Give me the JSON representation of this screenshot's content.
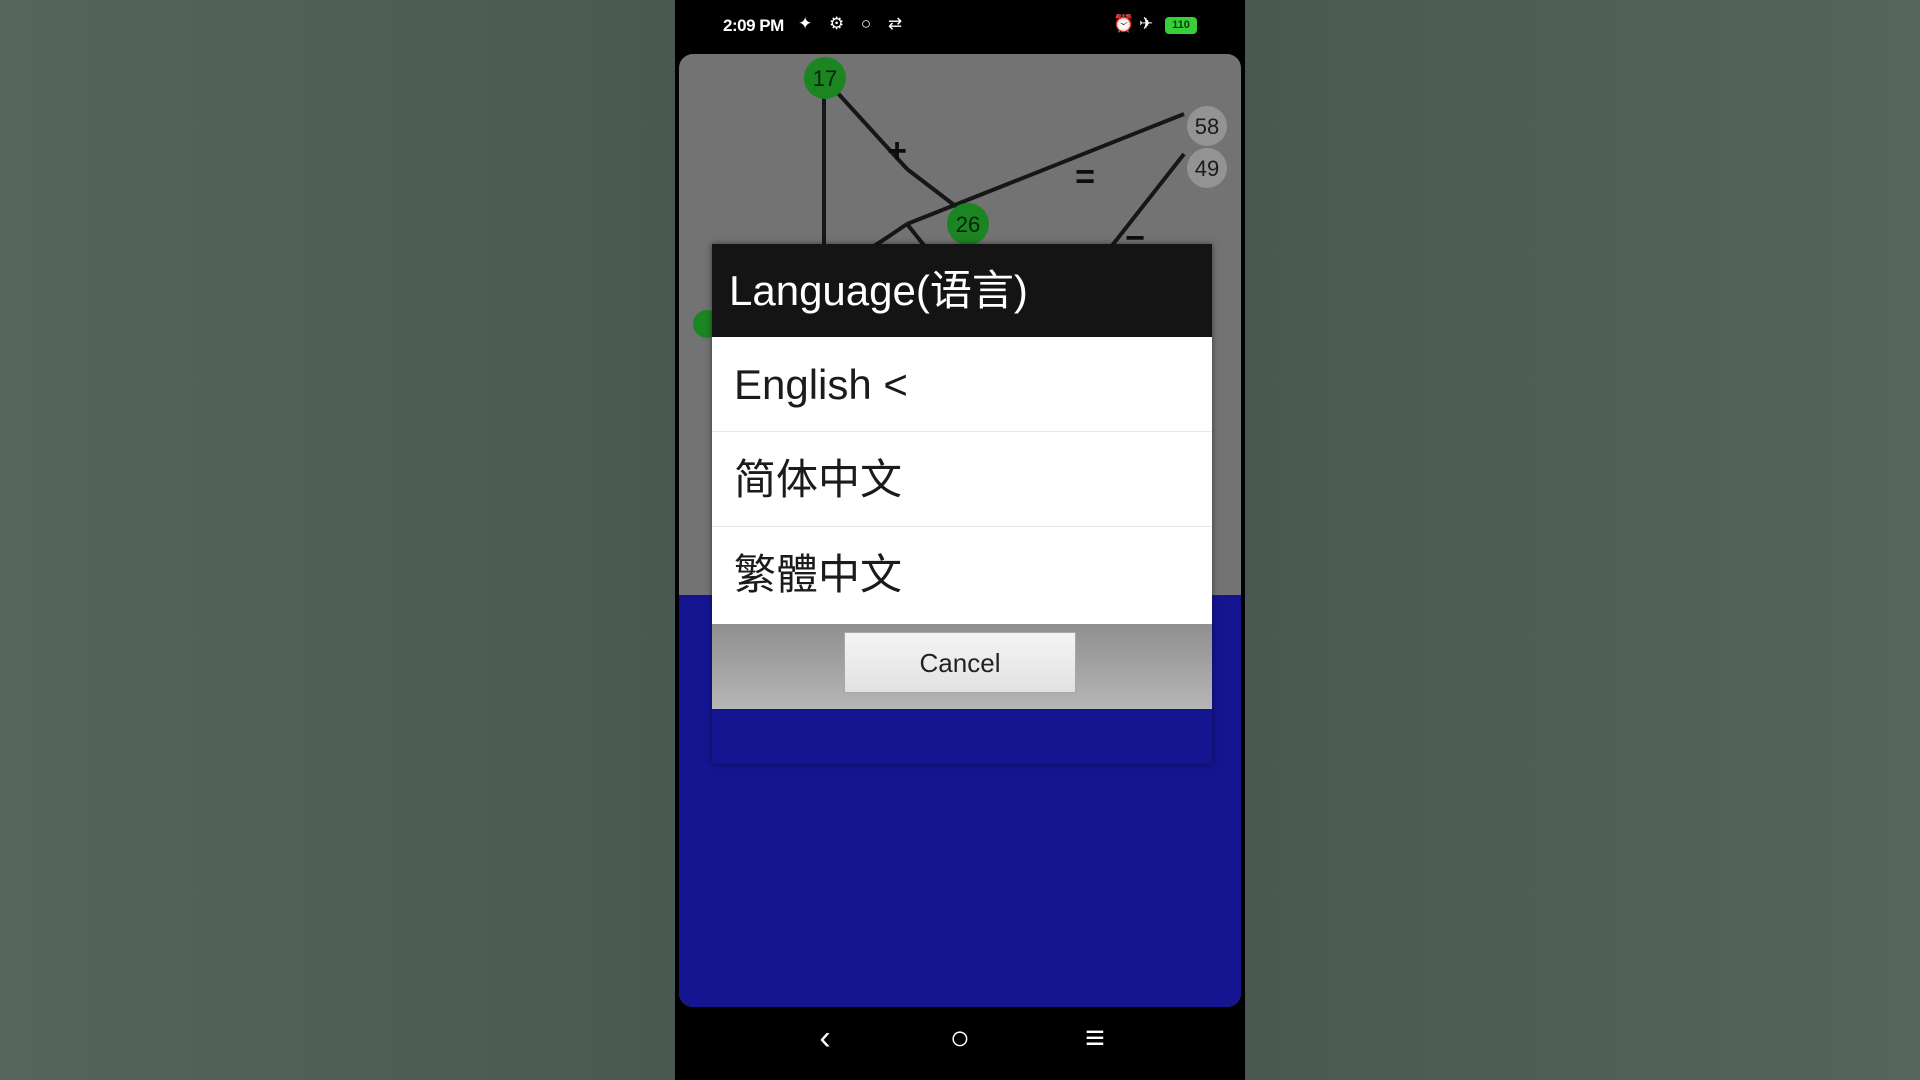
{
  "status_bar": {
    "time": "2:09 PM",
    "left_icons": "✦ ⚙ ○ ⇄",
    "right_icons": "⏰ ✈",
    "battery": "110"
  },
  "game": {
    "nodes": [
      "17",
      "26",
      "58",
      "49"
    ],
    "operators": [
      "+",
      "+",
      "+",
      "=",
      "="
    ]
  },
  "dialog": {
    "title": "Language(语言)",
    "options": [
      {
        "label": "English <",
        "selected": true
      },
      {
        "label": "简体中文",
        "selected": false
      },
      {
        "label": "繁體中文",
        "selected": false
      }
    ],
    "cancel_label": "Cancel"
  },
  "nav": {
    "back_icon": "‹",
    "home_icon": "○",
    "menu_icon": "≡"
  },
  "colors": {
    "node_green": "#22a32a",
    "game_bottom_blue": "#1a1ab3",
    "dialog_header": "#141414"
  }
}
